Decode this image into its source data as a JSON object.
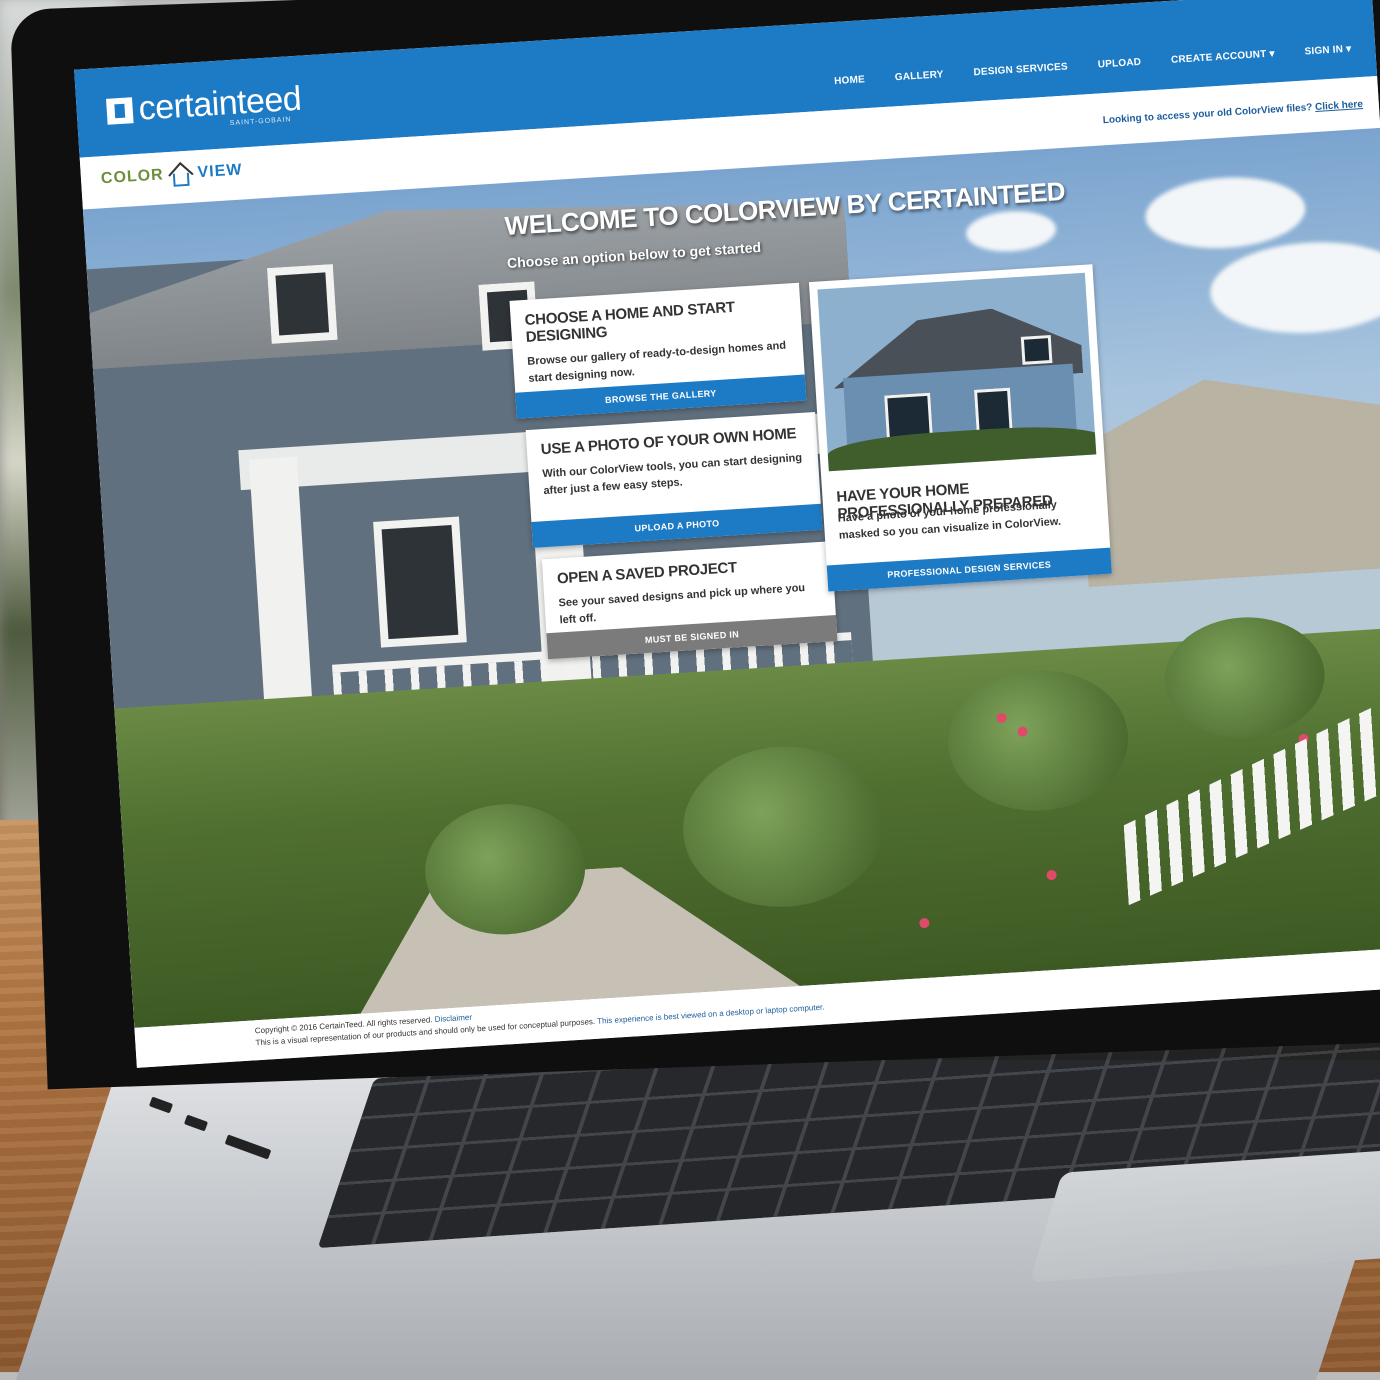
{
  "header": {
    "brand": "certainteed",
    "brand_sub": "SAINT-GOBAIN",
    "nav": [
      "HOME",
      "GALLERY",
      "DESIGN SERVICES",
      "UPLOAD",
      "CREATE ACCOUNT ▾",
      "SIGN IN ▾"
    ]
  },
  "subbar": {
    "app_name_left": "COLOR",
    "app_name_right": "VIEW",
    "old_files_text": "Looking to access your old ColorView files?",
    "old_files_link": "Click here"
  },
  "hero": {
    "title": "Welcome to ColorView by CertainTeed",
    "subtitle": "Choose an option below to get started"
  },
  "cards": [
    {
      "title": "Choose a home and start designing",
      "body": "Browse our gallery of ready-to-design homes and start designing now.",
      "button": "Browse the gallery"
    },
    {
      "title": "Use a photo of your own home",
      "body": "With our ColorView tools, you can start designing after just a few easy steps.",
      "button": "Upload a photo"
    },
    {
      "title": "Open a saved project",
      "body": "See your saved designs and pick up where you left off.",
      "button": "Must be signed in"
    },
    {
      "title": "Have your home professionally prepared",
      "body": "Have a photo of your home professionally masked so you can visualize in ColorView.",
      "button": "Professional design services"
    }
  ],
  "footer": {
    "copyright": "Copyright © 2016 CertainTeed. All rights reserved.",
    "disclaimer_link": "Disclaimer",
    "line2": "This is a visual representation of our products and should only be used for conceptual purposes.",
    "line2_link": "This experience is best viewed on a desktop or laptop computer."
  },
  "colors": {
    "brand_blue": "#1d7bc5",
    "disabled_gray": "#7b7b7b",
    "colorview_green": "#6b8f3a"
  }
}
